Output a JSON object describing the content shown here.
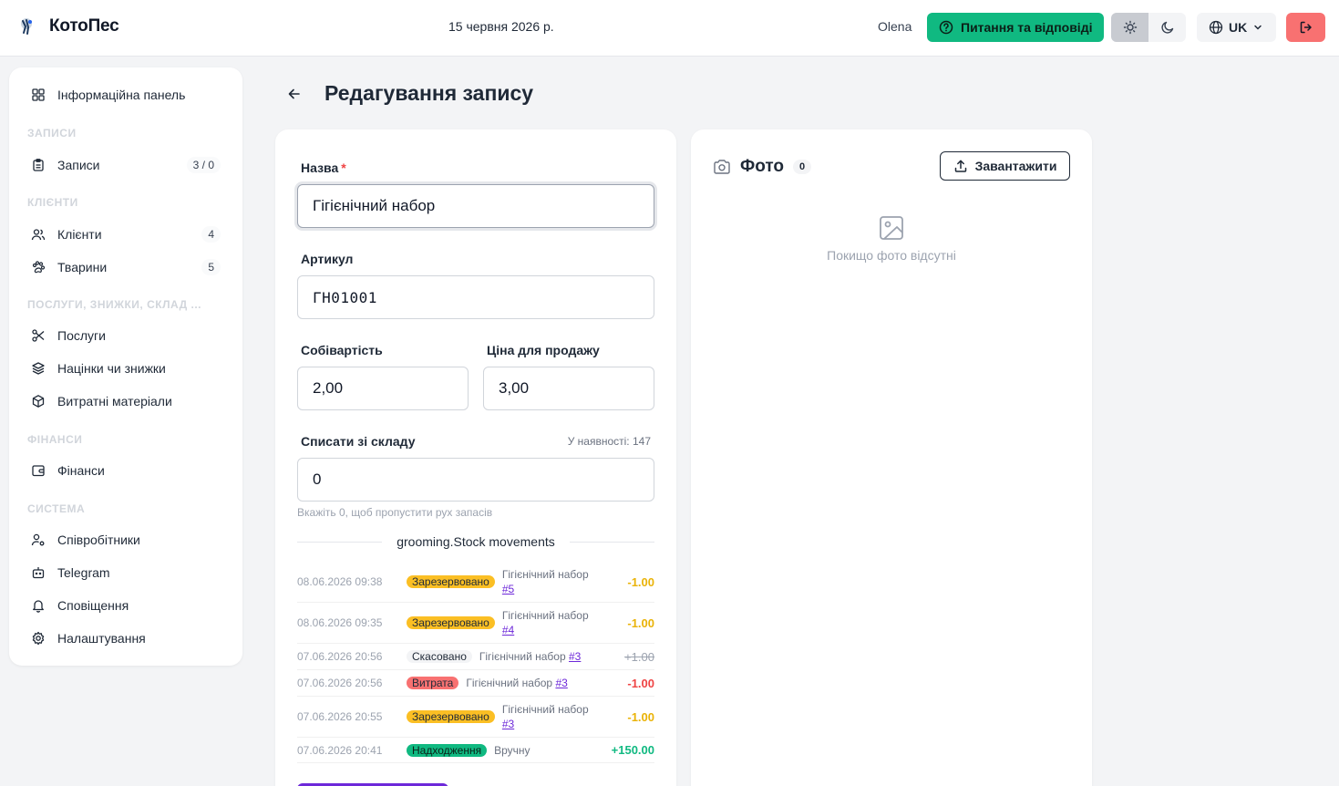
{
  "header": {
    "app_name": "КотоПес",
    "date": "15 червня 2026 р.",
    "user": "Olena",
    "qa_label": "Питання та відповіді",
    "lang": "UK"
  },
  "sidebar": {
    "dashboard": "Інформаційна панель",
    "sections": {
      "records": "Записи",
      "clients": "Клієнти",
      "services": "Послуги, знижки, склад ...",
      "finance": "Фінанси",
      "system": "Система"
    },
    "items": {
      "records": {
        "label": "Записи",
        "badge": "3 / 0"
      },
      "clients": {
        "label": "Клієнти",
        "badge": "4"
      },
      "animals": {
        "label": "Тварини",
        "badge": "5"
      },
      "services": {
        "label": "Послуги"
      },
      "markups": {
        "label": "Націнки чи знижки"
      },
      "supplies": {
        "label": "Витратні матеріали"
      },
      "finance": {
        "label": "Фінанси"
      },
      "employees": {
        "label": "Співробітники"
      },
      "telegram": {
        "label": "Telegram"
      },
      "notifications": {
        "label": "Сповіщення"
      },
      "settings": {
        "label": "Налаштування"
      }
    }
  },
  "page": {
    "title": "Редагування запису"
  },
  "form": {
    "name_label": "Назва",
    "required_mark": "*",
    "name_value": "Гігієнічний набор",
    "sku_label": "Артикул",
    "sku_value": "ГН01001",
    "cost_label": "Собівартість",
    "cost_value": "2,00",
    "price_label": "Ціна для продажу",
    "price_value": "3,00",
    "writeoff_label": "Списати зі складу",
    "stock_info": "У наявності: 147",
    "writeoff_value": "0",
    "hint": "Вкажіть 0, щоб пропустити рух запасів",
    "movements_title": "grooming.Stock movements",
    "movements": [
      {
        "date": "08.06.2026 09:38",
        "status": "Зарезервовано",
        "desc": "Гігієнічний набор",
        "link": "#5",
        "amount": "-1.00"
      },
      {
        "date": "08.06.2026 09:35",
        "status": "Зарезервовано",
        "desc": "Гігієнічний набор",
        "link": "#4",
        "amount": "-1.00"
      },
      {
        "date": "07.06.2026 20:56",
        "status": "Скасовано",
        "desc": "Гігієнічний набор",
        "link": "#3",
        "amount": "+1.00"
      },
      {
        "date": "07.06.2026 20:56",
        "status": "Витрата",
        "desc": "Гігієнічний набор",
        "link": "#3",
        "amount": "-1.00"
      },
      {
        "date": "07.06.2026 20:55",
        "status": "Зарезервовано",
        "desc": "Гігієнічний набор",
        "link": "#3",
        "amount": "-1.00"
      },
      {
        "date": "07.06.2026 20:41",
        "status": "Надходження",
        "desc": "Вручну",
        "link": "",
        "amount": "+150.00"
      }
    ]
  },
  "photo": {
    "title": "Фото",
    "count": "0",
    "upload_label": "Завантажити",
    "empty_text": "Покищо фото відсутні"
  },
  "colors": {
    "accent_green": "#10b981",
    "danger": "#f87171",
    "reserved": "#fbbf24",
    "link": "#6d28d9"
  }
}
